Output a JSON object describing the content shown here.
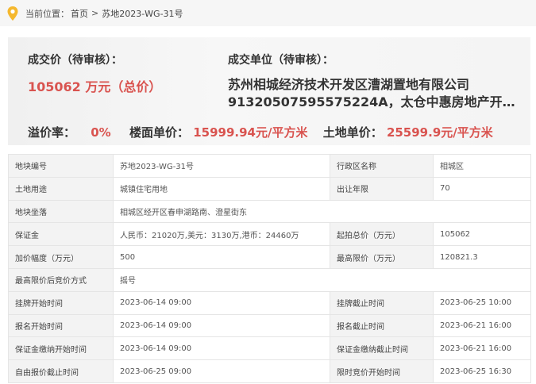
{
  "breadcrumb": {
    "label": "当前位置：",
    "home": "首页",
    "separator": ">",
    "current": "苏地2023-WG-31号"
  },
  "summary": {
    "price_label": "成交价（待审核）：",
    "price_value": "105062 万元（总价）",
    "winner_label": "成交单位（待审核）：",
    "winner_line1": "苏州相城经济技术开发区漕湖置地有限公司",
    "winner_line2": "91320507595575224A，太仓中惠房地产开…",
    "premium_label": "溢价率：",
    "premium_value": "0%",
    "floor_price_label": "楼面单价：",
    "floor_price_value": "15999.94元/平方米",
    "land_price_label": "土地单价：",
    "land_price_value": "25599.9元/平方米"
  },
  "details": {
    "r0": {
      "l1": "地块编号",
      "v1": "苏地2023-WG-31号",
      "l2": "行政区名称",
      "v2": "相城区"
    },
    "r1": {
      "l1": "土地用途",
      "v1": "城镇住宅用地",
      "l2": "出让年限",
      "v2": "70"
    },
    "r2": {
      "l1": "地块坐落",
      "v1": "相城区经开区春申湖路南、澄星街东"
    },
    "r3": {
      "l1": "保证金",
      "v1": "人民币：21020万,美元：3130万,港币：24460万",
      "l2": "起拍总价（万元）",
      "v2": "105062"
    },
    "r4": {
      "l1": "加价幅度（万元）",
      "v1": "500",
      "l2": "最高限价（万元）",
      "v2": "120821.3"
    },
    "r5": {
      "l1": "最高限价后竞价方式",
      "v1": "摇号"
    },
    "r6": {
      "l1": "挂牌开始时间",
      "v1": "2023-06-14 09:00",
      "l2": "挂牌截止时间",
      "v2": "2023-06-25 10:00"
    },
    "r7": {
      "l1": "报名开始时间",
      "v1": "2023-06-14 09:00",
      "l2": "报名截止时间",
      "v2": "2023-06-21 16:00"
    },
    "r8": {
      "l1": "保证金缴纳开始时间",
      "v1": "2023-06-14 09:00",
      "l2": "保证金缴纳截止时间",
      "v2": "2023-06-21 16:00"
    },
    "r9": {
      "l1": "自由报价截止时间",
      "v1": "2023-06-25 09:00",
      "l2": "限时竞价开始时间",
      "v2": "2023-06-25 16:30"
    }
  },
  "colors": {
    "accent_red": "#d9534f",
    "pin_yellow": "#f5b82e"
  },
  "icons": {
    "location": "location-pin-icon"
  }
}
